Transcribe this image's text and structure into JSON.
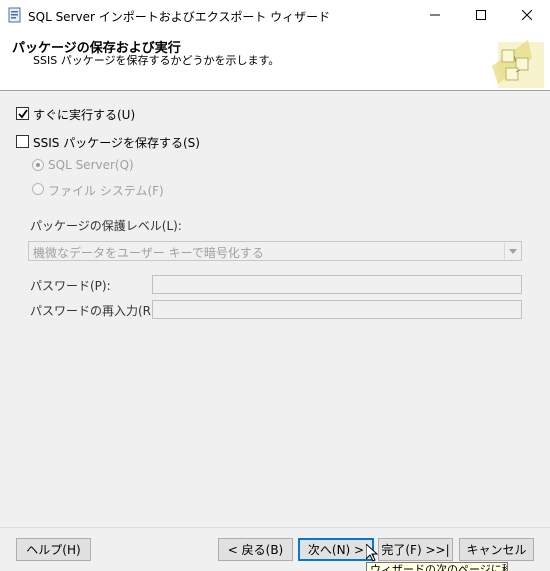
{
  "window": {
    "title": "SQL Server インポートおよびエクスポート ウィザード",
    "minimize_glyph": "—",
    "maximize_glyph": "☐",
    "close_glyph": "✕"
  },
  "header": {
    "title": "パッケージの保存および実行",
    "subtitle": "SSIS パッケージを保存するかどうかを示します。"
  },
  "options": {
    "run_immediately": {
      "label": "すぐに実行する(U)",
      "checked": true
    },
    "save_package": {
      "label": "SSIS パッケージを保存する(S)",
      "checked": false
    },
    "sql_server": {
      "label": "SQL Server(Q)",
      "selected": true,
      "enabled": false
    },
    "file_system": {
      "label": "ファイル システム(F)",
      "selected": false,
      "enabled": false
    }
  },
  "protection": {
    "label": "パッケージの保護レベル(L):",
    "value": "機微なデータをユーザー キーで暗号化する"
  },
  "password": {
    "label": "パスワード(P):",
    "value": ""
  },
  "password_confirm": {
    "label": "パスワードの再入力(R):",
    "value": ""
  },
  "footer": {
    "help": "ヘルプ(H)",
    "back": "< 戻る(B)",
    "next": "次へ(N) >",
    "finish": "完了(F) >>|",
    "cancel": "キャンセル"
  },
  "tooltip": {
    "text": "ウィザードの次のページに移動"
  },
  "colors": {
    "content_bg": "#f0f0f0",
    "header_bg": "#ffffff",
    "focus_border": "#0078d7",
    "disabled_text": "#a0a0a0",
    "tooltip_bg": "#ffffe1"
  },
  "icons": {
    "app": "wizard-app-icon",
    "graphic": "wizard-header-graphic",
    "checkmark": "checkmark-icon",
    "dropdown": "chevron-down-icon",
    "cursor": "mouse-cursor-icon"
  }
}
